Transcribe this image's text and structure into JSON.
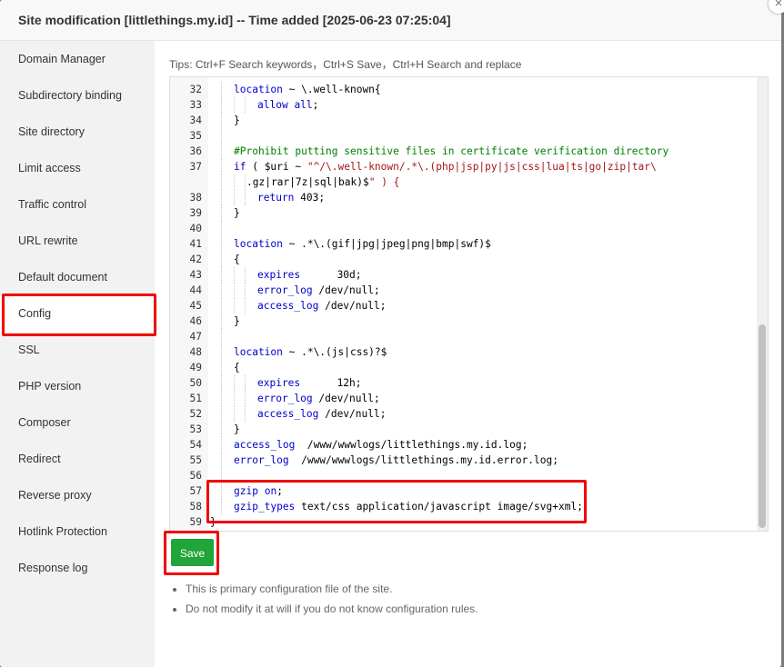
{
  "dialog": {
    "title": "Site modification [littlethings.my.id] -- Time added [2025-06-23 07:25:04]",
    "close_icon": "×"
  },
  "sidebar": {
    "items": [
      {
        "label": "Domain Manager"
      },
      {
        "label": "Subdirectory binding"
      },
      {
        "label": "Site directory"
      },
      {
        "label": "Limit access"
      },
      {
        "label": "Traffic control"
      },
      {
        "label": "URL rewrite"
      },
      {
        "label": "Default document"
      },
      {
        "label": "Config",
        "active": true
      },
      {
        "label": "SSL"
      },
      {
        "label": "PHP version"
      },
      {
        "label": "Composer"
      },
      {
        "label": "Redirect"
      },
      {
        "label": "Reverse proxy"
      },
      {
        "label": "Hotlink Protection"
      },
      {
        "label": "Response log"
      }
    ]
  },
  "tips": "Tips:  Ctrl+F Search keywords，Ctrl+S Save，Ctrl+H Search and replace",
  "code_lines": [
    {
      "n": "32",
      "indent": 1,
      "text": "location ~ \\.well-known{"
    },
    {
      "n": "33",
      "indent": 2,
      "text": "allow all;"
    },
    {
      "n": "34",
      "indent": 1,
      "text": "}"
    },
    {
      "n": "35",
      "indent": 1,
      "text": ""
    },
    {
      "n": "36",
      "indent": 1,
      "text": "#Prohibit putting sensitive files in certificate verification directory"
    },
    {
      "n": "37",
      "indent": 1,
      "text": "if ( $uri ~ \"^/\\.well-known/.*\\.(php|jsp|py|js|css|lua|ts|go|zip|tar\\"
    },
    {
      "n": "",
      "indent": 3,
      "text": ".gz|rar|7z|sql|bak)$\" ) {"
    },
    {
      "n": "38",
      "indent": 2,
      "text": "return 403;"
    },
    {
      "n": "39",
      "indent": 1,
      "text": "}"
    },
    {
      "n": "40",
      "indent": 1,
      "text": ""
    },
    {
      "n": "41",
      "indent": 1,
      "text": "location ~ .*\\.(gif|jpg|jpeg|png|bmp|swf)$"
    },
    {
      "n": "42",
      "indent": 1,
      "text": "{"
    },
    {
      "n": "43",
      "indent": 2,
      "text": "expires      30d;"
    },
    {
      "n": "44",
      "indent": 2,
      "text": "error_log /dev/null;"
    },
    {
      "n": "45",
      "indent": 2,
      "text": "access_log /dev/null;"
    },
    {
      "n": "46",
      "indent": 1,
      "text": "}"
    },
    {
      "n": "47",
      "indent": 1,
      "text": ""
    },
    {
      "n": "48",
      "indent": 1,
      "text": "location ~ .*\\.(js|css)?$"
    },
    {
      "n": "49",
      "indent": 1,
      "text": "{"
    },
    {
      "n": "50",
      "indent": 2,
      "text": "expires      12h;"
    },
    {
      "n": "51",
      "indent": 2,
      "text": "error_log /dev/null;"
    },
    {
      "n": "52",
      "indent": 2,
      "text": "access_log /dev/null;"
    },
    {
      "n": "53",
      "indent": 1,
      "text": "}"
    },
    {
      "n": "54",
      "indent": 1,
      "text": "access_log  /www/wwwlogs/littlethings.my.id.log;"
    },
    {
      "n": "55",
      "indent": 1,
      "text": "error_log  /www/wwwlogs/littlethings.my.id.error.log;"
    },
    {
      "n": "56",
      "indent": 1,
      "text": ""
    },
    {
      "n": "57",
      "indent": 1,
      "text": "gzip on;"
    },
    {
      "n": "58",
      "indent": 1,
      "text": "gzip_types text/css application/javascript image/svg+xml;"
    },
    {
      "n": "59",
      "indent": 0,
      "text": "}"
    }
  ],
  "save_label": "Save",
  "notes": [
    "This is primary configuration file of the site.",
    "Do not modify it at will if you do not know configuration rules."
  ],
  "colors": {
    "save_button": "#20a53a",
    "highlight": "#f10000",
    "comment": "#008000",
    "keyword": "#0000cc"
  }
}
